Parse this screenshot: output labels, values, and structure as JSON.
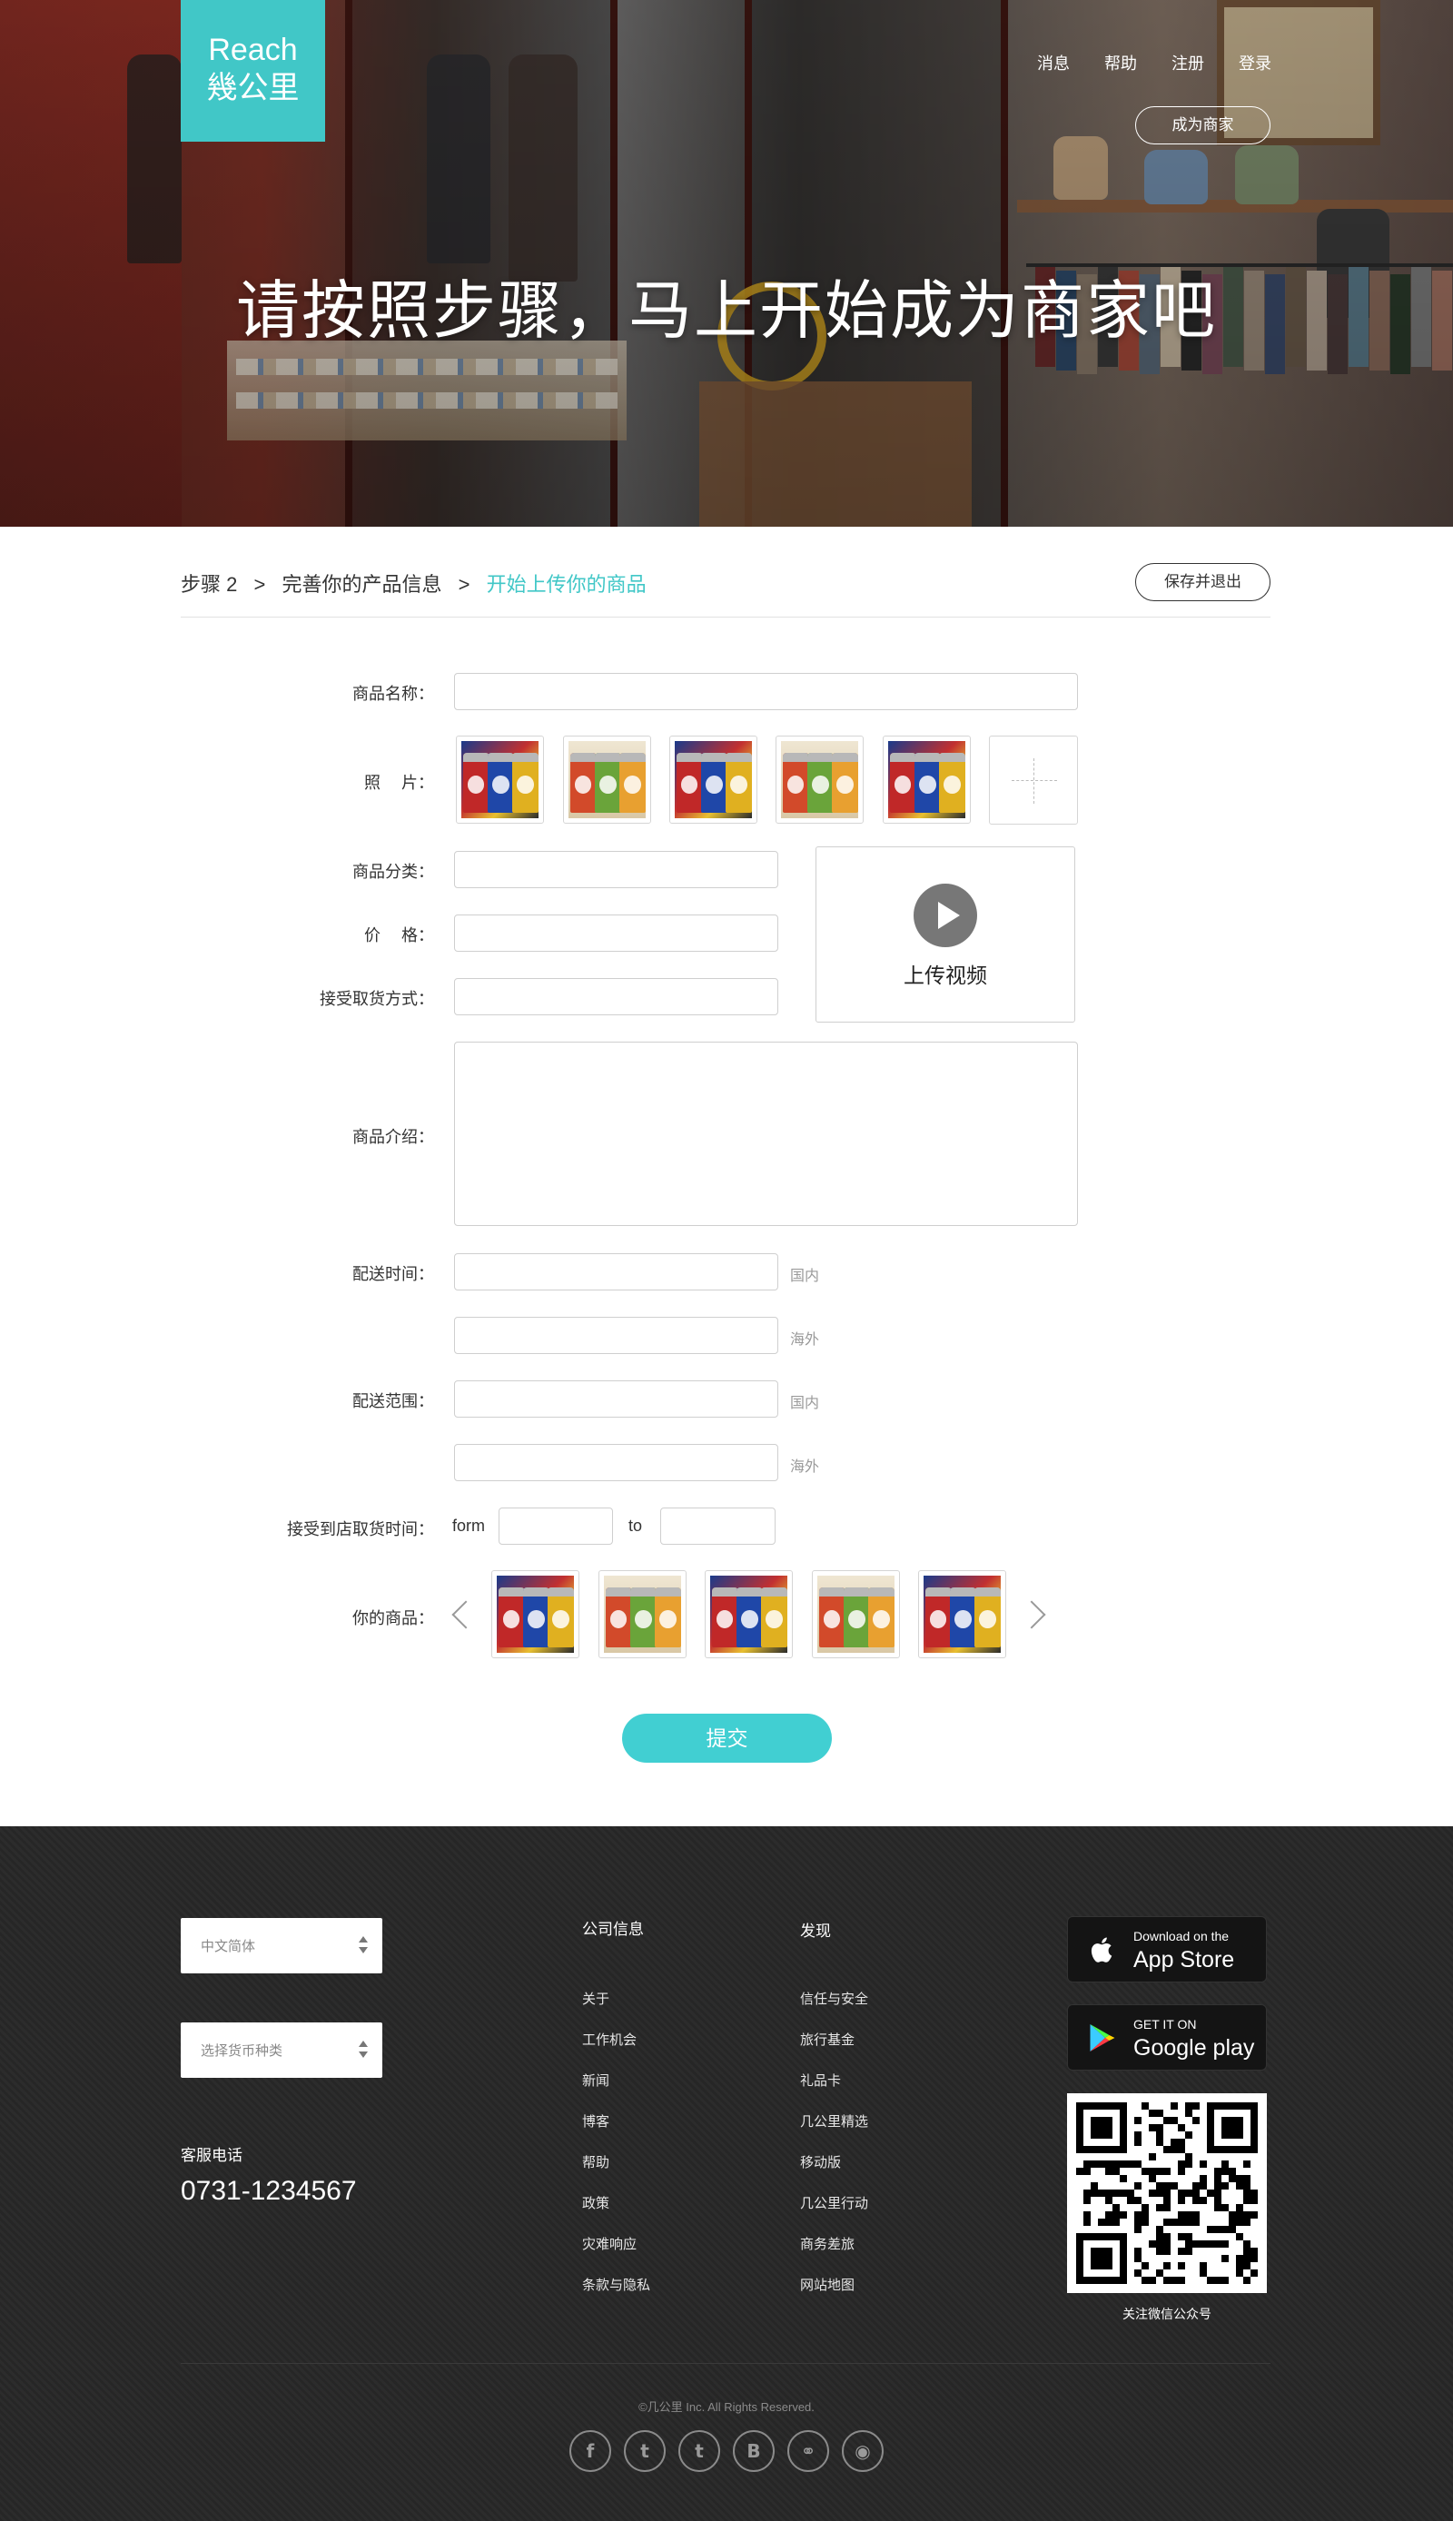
{
  "brand": {
    "logo_line1": "Reach",
    "logo_line2": "幾公里",
    "accent": "#41c7c7"
  },
  "topnav": [
    "消息",
    "帮助",
    "注册",
    "登录"
  ],
  "merchant_button": "成为商家",
  "hero_title": "请按照步骤，马上开始成为商家吧",
  "steps": {
    "step": "步骤 2",
    "sep": ">",
    "current": "完善你的产品信息",
    "next": "开始上传你的商品",
    "save_button": "保存并退出"
  },
  "form": {
    "name_label": "商品名称：",
    "photo_label": "照　 片：",
    "category_label": "商品分类：",
    "price_label": "价　 格：",
    "pickup_label": "接受取货方式：",
    "video_label": "上传视频",
    "intro_label": "商品介绍：",
    "delivery_time_label": "配送时间：",
    "delivery_range_label": "配送范围：",
    "domestic": "国内",
    "overseas": "海外",
    "store_pickup_label": "接受到店取货时间：",
    "from_word": "form",
    "to_word": "to",
    "your_products_label": "你的商品：",
    "submit": "提交"
  },
  "footer": {
    "language_select": "中文简体",
    "currency_select": "选择货币种类",
    "hotline_label": "客服电话",
    "hotline": "0731-1234567",
    "col1_title": "公司信息",
    "col1": [
      "关于",
      "工作机会",
      "新闻",
      "博客",
      "帮助",
      "政策",
      "灾难响应",
      "条款与隐私"
    ],
    "col2_title": "发现",
    "col2": [
      "信任与安全",
      "旅行基金",
      "礼品卡",
      "几公里精选",
      "移动版",
      "几公里行动",
      "商务差旅",
      "网站地图"
    ],
    "appstore_small": "Download on the",
    "appstore_big": "App Store",
    "googleplay_small": "GET IT ON",
    "googleplay_big": "Google play",
    "qr_caption": "关注微信公众号",
    "copyright": "©几公里 Inc. All Rights Reserved.",
    "social_icons": [
      "facebook-icon",
      "twitter-icon",
      "tumblr-icon",
      "blogger-icon",
      "wechat-icon",
      "weibo-icon"
    ]
  }
}
